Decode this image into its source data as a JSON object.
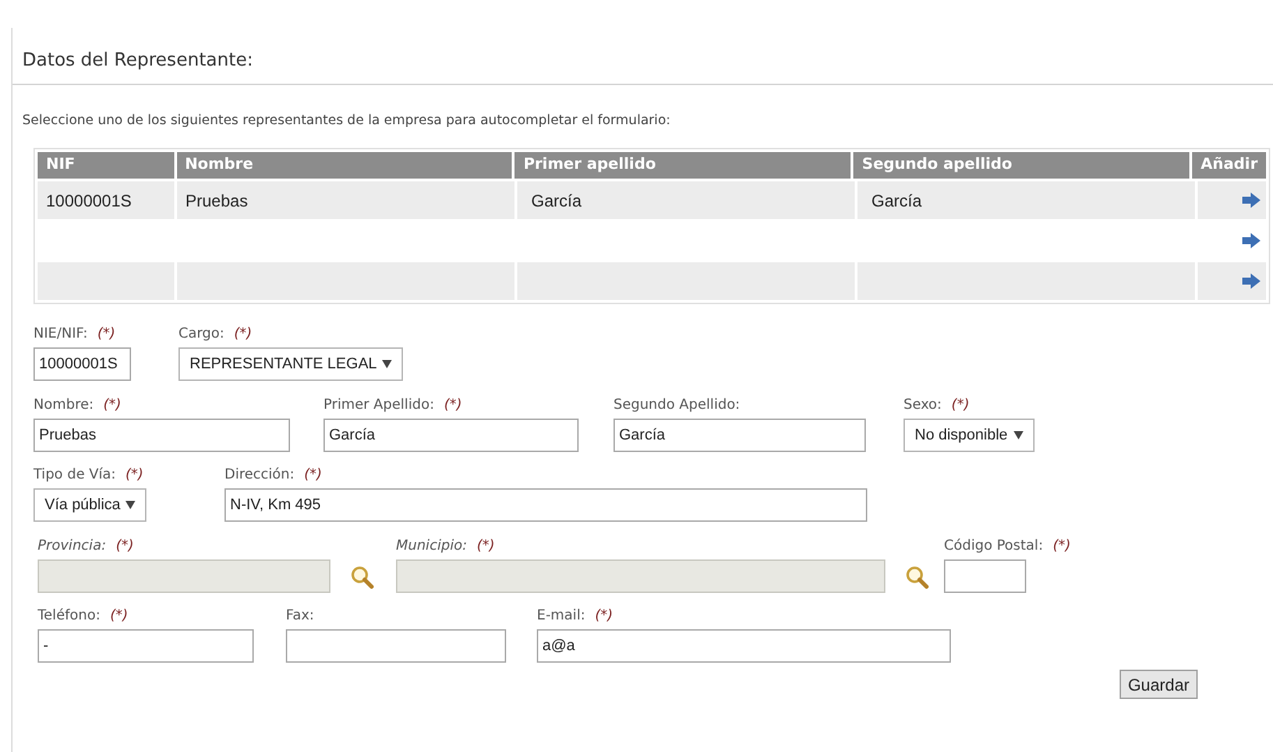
{
  "section_title": "Datos del Representante:",
  "instructions": "Seleccione uno de los siguientes representantes de la empresa para autocompletar el formulario:",
  "table": {
    "columns": [
      "NIF",
      "Nombre",
      "Primer apellido",
      "Segundo apellido",
      "Añadir"
    ],
    "rows": [
      {
        "kind": "filled",
        "cells": [
          "10000001S",
          "Pruebas",
          "García",
          "García"
        ]
      },
      {
        "kind": "empty"
      },
      {
        "kind": "empty"
      }
    ]
  },
  "form": {
    "groups": [
      {
        "fields": [
          {
            "kind": "input",
            "label": "NIE/NIF:",
            "required_mark": "(*)",
            "value": "10000001S"
          },
          {
            "kind": "select",
            "label": "Cargo:",
            "required_mark": "(*)",
            "value": "REPRESENTANTE LEGAL"
          }
        ]
      },
      {
        "fields": [
          {
            "kind": "input",
            "label": "Nombre:",
            "required_mark": "(*)",
            "value": "Pruebas"
          },
          {
            "kind": "input",
            "label": "Primer Apellido:",
            "required_mark": "(*)",
            "value": "García"
          },
          {
            "kind": "input",
            "label": "Segundo Apellido:",
            "value": "García"
          },
          {
            "kind": "select",
            "label": "Sexo:",
            "required_mark": "(*)",
            "value": "No disponible"
          }
        ]
      },
      {
        "fields": [
          {
            "kind": "select",
            "label": "Tipo de Vía:",
            "required_mark": "(*)",
            "value": "Vía pública"
          },
          {
            "kind": "input",
            "label": "Dirección:",
            "required_mark": "(*)",
            "value": "N-IV, Km 495"
          }
        ]
      },
      {
        "fields": [
          {
            "kind": "input",
            "label": "Provincia:",
            "required_mark": "(*)",
            "disabled": true,
            "lookup": true
          },
          {
            "kind": "input",
            "label": "Municipio:",
            "required_mark": "(*)",
            "disabled": true,
            "lookup": true
          },
          {
            "kind": "input",
            "label": "Código Postal:",
            "required_mark": "(*)"
          }
        ]
      },
      {
        "fields": [
          {
            "kind": "input",
            "label": "Teléfono:",
            "required_mark": "(*)",
            "value": "-"
          },
          {
            "kind": "input",
            "label": "Fax:"
          },
          {
            "kind": "input",
            "label": "E-mail:",
            "required_mark": "(*)",
            "value": "a@a"
          }
        ]
      }
    ]
  },
  "save_button": "Guardar"
}
